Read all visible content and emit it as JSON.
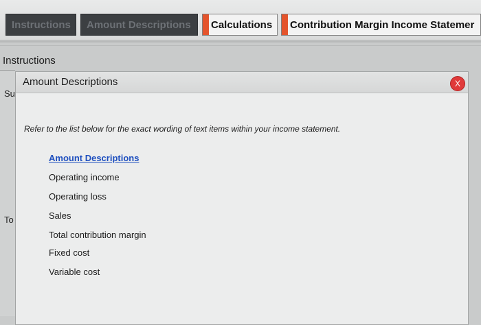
{
  "tabs": [
    {
      "label": "Instructions",
      "state": "inactive"
    },
    {
      "label": "Amount Descriptions",
      "state": "inactive"
    },
    {
      "label": "Calculations",
      "state": "active"
    },
    {
      "label": "Contribution Margin Income Statemer",
      "state": "active"
    }
  ],
  "page": {
    "section_title": "Instructions",
    "left_stub_top": "Su",
    "left_stub_mid": "To"
  },
  "modal": {
    "title": "Amount Descriptions",
    "close_label": "X",
    "hint": "Refer to the list below for the exact wording of text items within your income statement.",
    "list_header": "Amount Descriptions",
    "items": [
      "Operating income",
      "Operating loss",
      "Sales",
      "Total contribution margin",
      "Fixed cost",
      "Variable cost"
    ]
  },
  "colors": {
    "tab_flag": "#e4542c",
    "close_button": "#e03a3a",
    "link_blue": "#1e4fbf"
  }
}
